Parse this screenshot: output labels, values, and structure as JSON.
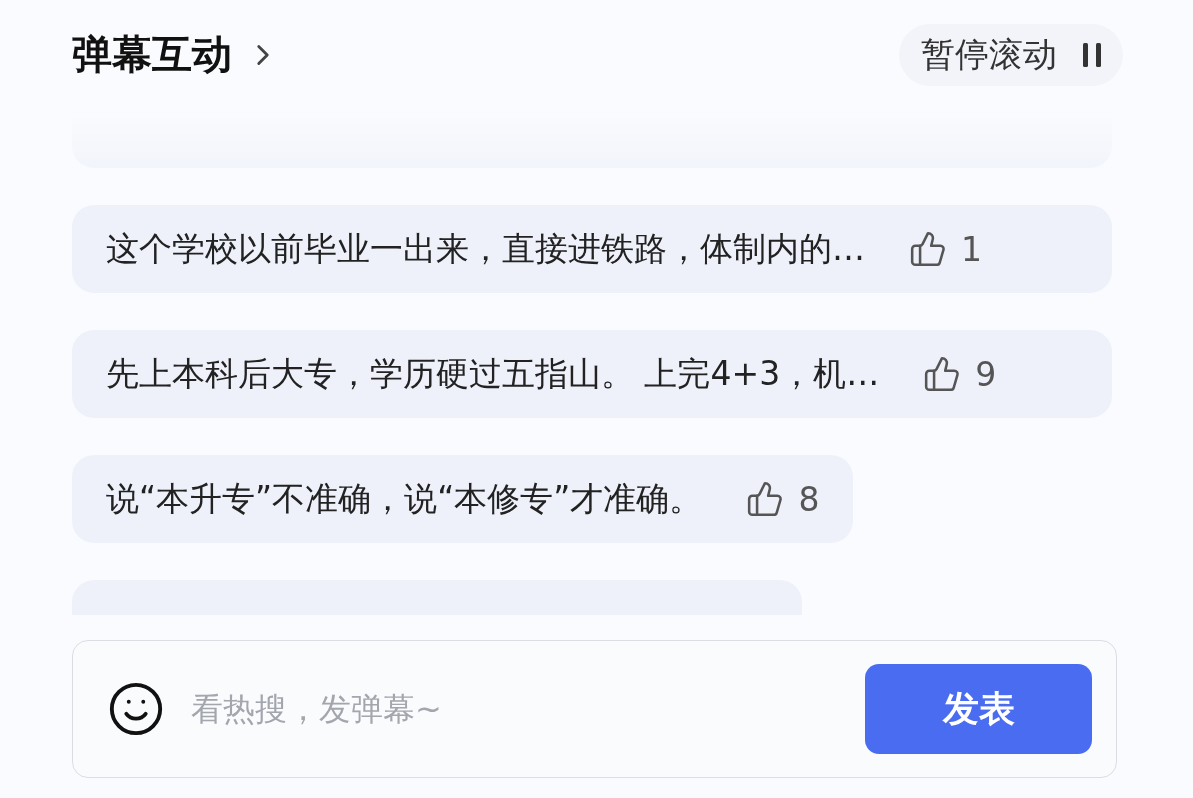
{
  "header": {
    "title": "弹幕互动",
    "pause_button": "暂停滚动"
  },
  "messages": [
    {
      "text": "这个学校以前毕业一出来，直接进铁路，体制内的…",
      "likes": "1"
    },
    {
      "text": "先上本科后大专，学历硬过五指山。 上完4+3，机…",
      "likes": "9"
    },
    {
      "text": "说“本升专”不准确，说“本修专”才准确。",
      "likes": "8"
    }
  ],
  "composer": {
    "placeholder": "看热搜，发弹幕~",
    "submit": "发表"
  }
}
